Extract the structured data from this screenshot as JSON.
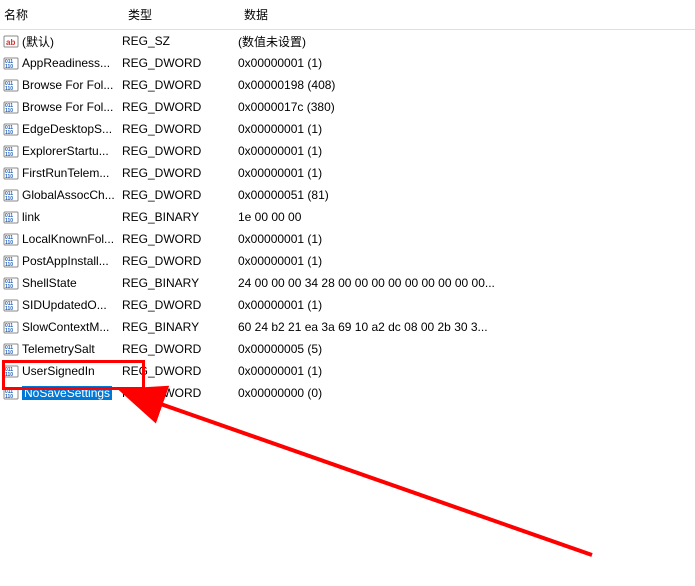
{
  "headers": {
    "name": "名称",
    "type": "类型",
    "data": "数据"
  },
  "rows": [
    {
      "iconType": "sz",
      "name": "(默认)",
      "type": "REG_SZ",
      "data": "(数值未设置)",
      "selected": false
    },
    {
      "iconType": "bin",
      "name": "AppReadiness...",
      "type": "REG_DWORD",
      "data": "0x00000001 (1)",
      "selected": false
    },
    {
      "iconType": "bin",
      "name": "Browse For Fol...",
      "type": "REG_DWORD",
      "data": "0x00000198 (408)",
      "selected": false
    },
    {
      "iconType": "bin",
      "name": "Browse For Fol...",
      "type": "REG_DWORD",
      "data": "0x0000017c (380)",
      "selected": false
    },
    {
      "iconType": "bin",
      "name": "EdgeDesktopS...",
      "type": "REG_DWORD",
      "data": "0x00000001 (1)",
      "selected": false
    },
    {
      "iconType": "bin",
      "name": "ExplorerStartu...",
      "type": "REG_DWORD",
      "data": "0x00000001 (1)",
      "selected": false
    },
    {
      "iconType": "bin",
      "name": "FirstRunTelem...",
      "type": "REG_DWORD",
      "data": "0x00000001 (1)",
      "selected": false
    },
    {
      "iconType": "bin",
      "name": "GlobalAssocCh...",
      "type": "REG_DWORD",
      "data": "0x00000051 (81)",
      "selected": false
    },
    {
      "iconType": "bin",
      "name": "link",
      "type": "REG_BINARY",
      "data": "1e 00 00 00",
      "selected": false
    },
    {
      "iconType": "bin",
      "name": "LocalKnownFol...",
      "type": "REG_DWORD",
      "data": "0x00000001 (1)",
      "selected": false
    },
    {
      "iconType": "bin",
      "name": "PostAppInstall...",
      "type": "REG_DWORD",
      "data": "0x00000001 (1)",
      "selected": false
    },
    {
      "iconType": "bin",
      "name": "ShellState",
      "type": "REG_BINARY",
      "data": "24 00 00 00 34 28 00 00 00 00 00 00 00 00 00...",
      "selected": false
    },
    {
      "iconType": "bin",
      "name": "SIDUpdatedO...",
      "type": "REG_DWORD",
      "data": "0x00000001 (1)",
      "selected": false
    },
    {
      "iconType": "bin",
      "name": "SlowContextM...",
      "type": "REG_BINARY",
      "data": "60 24 b2 21 ea 3a 69 10 a2 dc 08 00 2b 30 3...",
      "selected": false
    },
    {
      "iconType": "bin",
      "name": "TelemetrySalt",
      "type": "REG_DWORD",
      "data": "0x00000005 (5)",
      "selected": false
    },
    {
      "iconType": "bin",
      "name": "UserSignedIn",
      "type": "REG_DWORD",
      "data": "0x00000001 (1)",
      "selected": false
    },
    {
      "iconType": "bin",
      "name": "NoSaveSettings",
      "type": "REG_DWORD",
      "data": "0x00000000 (0)",
      "selected": true
    }
  ],
  "annotation": {
    "highlight_color": "#ff0000",
    "arrow_color": "#ff0000"
  }
}
